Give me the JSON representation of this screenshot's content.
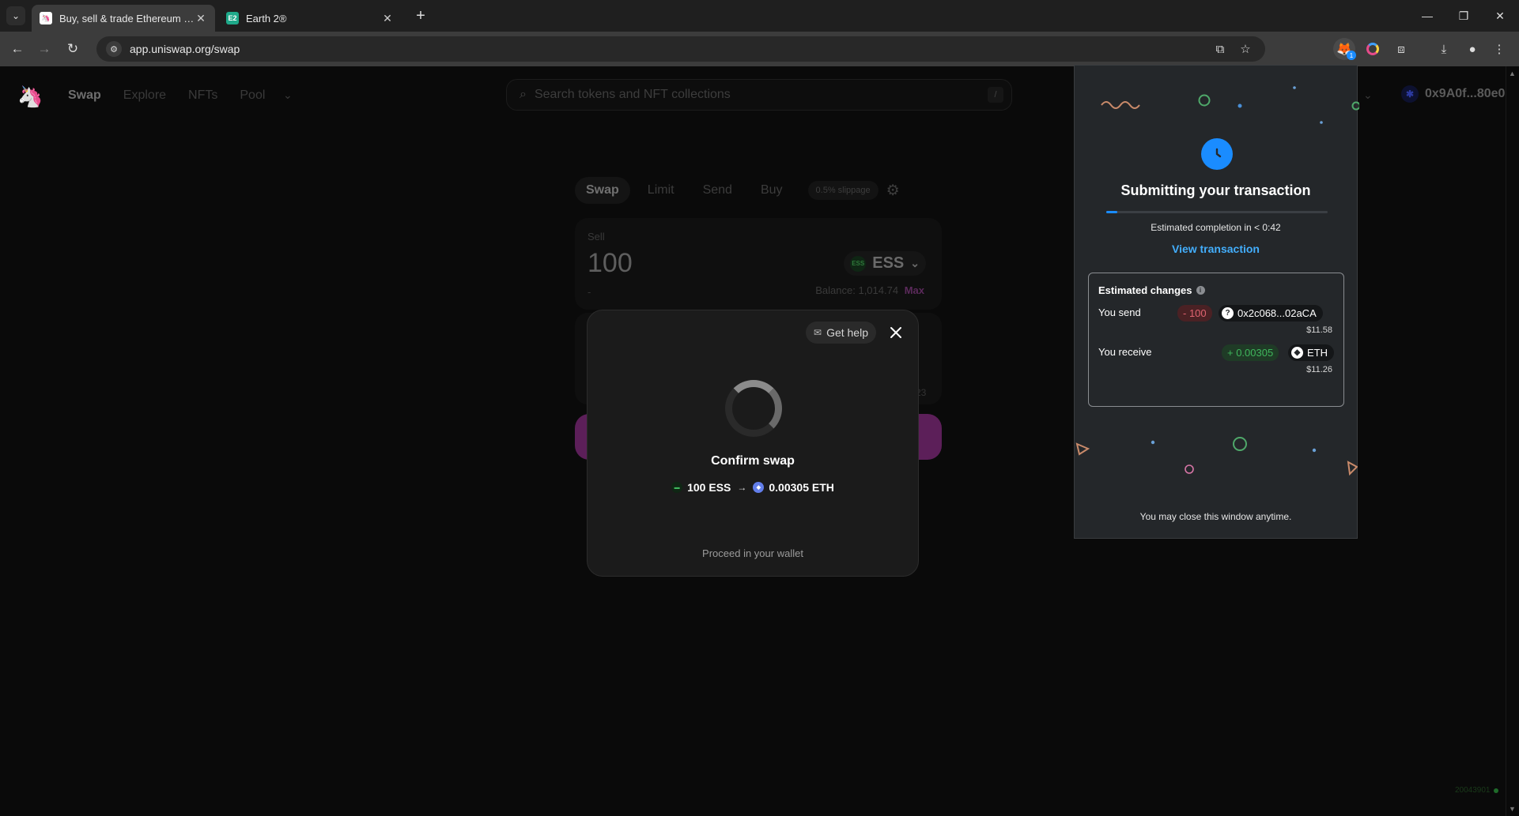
{
  "browser": {
    "tabs": [
      {
        "title": "Buy, sell & trade Ethereum and",
        "active": true
      },
      {
        "title": "Earth 2®",
        "active": false
      }
    ],
    "url": "app.uniswap.org/swap",
    "extension_badge": "1"
  },
  "uniswap": {
    "nav": [
      "Swap",
      "Explore",
      "NFTs",
      "Pool"
    ],
    "search_placeholder": "Search tokens and NFT collections",
    "search_shortcut": "/",
    "account": "0x9A0f...80e0",
    "swap_tabs": [
      "Swap",
      "Limit",
      "Send",
      "Buy"
    ],
    "slippage": "0.5% slippage",
    "sell": {
      "label": "Sell",
      "amount": "100",
      "usd": "-",
      "token": "ESS",
      "balance": "Balance: 1,014.74",
      "max": "Max"
    },
    "buy_fragment": "23",
    "build": "20043901"
  },
  "confirm_modal": {
    "get_help": "Get help",
    "title": "Confirm swap",
    "from": "100 ESS",
    "to": "0.00305 ETH",
    "footer": "Proceed in your wallet"
  },
  "wallet_popup": {
    "title": "Submitting your transaction",
    "progress": 0.05,
    "eta": "Estimated completion in < 0:42",
    "view_link": "View transaction",
    "changes_header": "Estimated changes",
    "send": {
      "label": "You send",
      "amount": "- 100",
      "asset": "0x2c068...02aCA",
      "usd": "$11.58"
    },
    "receive": {
      "label": "You receive",
      "amount": "+ 0.00305",
      "asset": "ETH",
      "usd": "$11.26"
    },
    "close_note": "You may close this window anytime."
  },
  "colors": {
    "accent_blue": "#1a8cff",
    "link_blue": "#43aefc",
    "negative": "#e06470",
    "positive": "#3fb65c",
    "uniswap_pink": "#5c1f59"
  }
}
